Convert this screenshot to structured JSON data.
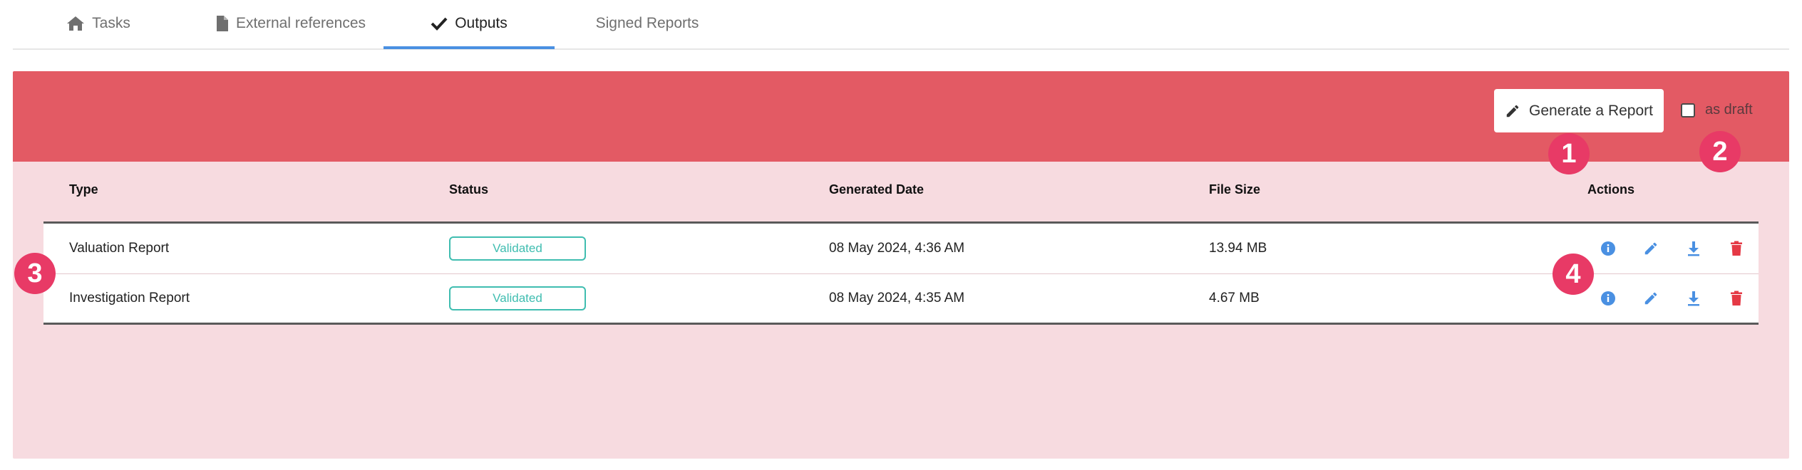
{
  "tabs": [
    {
      "label": "Tasks",
      "icon": "home-icon"
    },
    {
      "label": "External references",
      "icon": "file-icon"
    },
    {
      "label": "Outputs",
      "icon": "check-icon",
      "active": true
    },
    {
      "label": "Signed Reports"
    }
  ],
  "toolbar": {
    "generate_label": "Generate a Report",
    "draft_label": "as draft",
    "draft_checked": false
  },
  "table": {
    "headers": [
      "Type",
      "Status",
      "Generated Date",
      "File Size",
      "Actions"
    ],
    "rows": [
      {
        "type": "Valuation Report",
        "status": "Validated",
        "date": "08 May 2024, 4:36 AM",
        "size": "13.94 MB"
      },
      {
        "type": "Investigation Report",
        "status": "Validated",
        "date": "08 May 2024, 4:35 AM",
        "size": "4.67 MB"
      }
    ],
    "actions": [
      "info-icon",
      "edit-icon",
      "download-icon",
      "delete-icon"
    ]
  },
  "markers": [
    "1",
    "2",
    "3",
    "4"
  ],
  "colors": {
    "banner": "#e35a64",
    "panel": "#f7dbe0",
    "accent": "#4a90e2",
    "badge": "#3fbdb0",
    "delete": "#e53945",
    "marker": "#e83a66"
  }
}
